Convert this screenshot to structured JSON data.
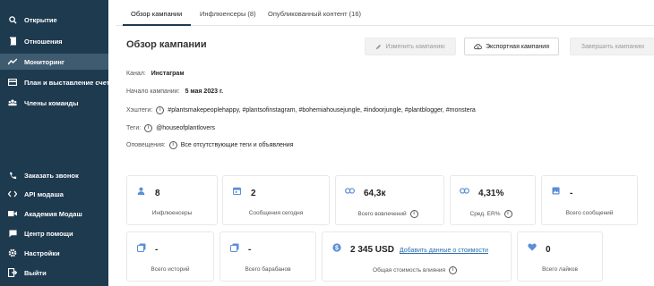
{
  "sidebar": {
    "top_items": [
      {
        "label": "Открытие",
        "icon": "search-icon"
      },
      {
        "label": "Отношения",
        "icon": "document-icon"
      },
      {
        "label": "Мониторинг",
        "icon": "trend-icon",
        "active": true
      },
      {
        "label": "План и выставление счето",
        "icon": "card-icon"
      },
      {
        "label": "Члены команды",
        "icon": "team-icon"
      }
    ],
    "bottom_items": [
      {
        "label": "Заказать звонок",
        "icon": "phone-icon"
      },
      {
        "label": "API модаша",
        "icon": "code-icon"
      },
      {
        "label": "Академия Модаш",
        "icon": "video-icon"
      },
      {
        "label": "Центр помощи",
        "icon": "chat-icon"
      },
      {
        "label": "Настройки",
        "icon": "gear-icon"
      },
      {
        "label": "Выйти",
        "icon": "logout-icon"
      }
    ]
  },
  "tabs": [
    {
      "label": "Обзор кампании",
      "active": true
    },
    {
      "label": "Инфлюенсеры (8)"
    },
    {
      "label": "Опубликованный контент (16)"
    }
  ],
  "header": {
    "title": "Обзор кампании",
    "edit_button": "Изменить кампанию",
    "export_button": "Экспортная кампания",
    "finish_button": "Завершить кампанию"
  },
  "details": {
    "channel_label": "Канал:",
    "channel_value": "Инстаграм",
    "start_label": "Начало кампании:",
    "start_value": "5 мая 2023 г.",
    "hashtags_label": "Хэштеги:",
    "hashtags_value": "#plantsmakepeoplehappy, #plantsofinstagram, #bohemiahousejungle, #indoorjungle, #plantblogger, #monstera",
    "tags_label": "Теги:",
    "tags_value": "@houseofplantlovers",
    "alerts_label": "Оповещения:",
    "alerts_value": "Все отсутствующие теги и объявления"
  },
  "stats_row1": [
    {
      "value": "8",
      "label": "Инфлюенсеры",
      "icon": "person-icon"
    },
    {
      "value": "2",
      "label": "Сообщения сегодня",
      "icon": "calendar-icon"
    },
    {
      "value": "64,3к",
      "label": "Всего вовлечений",
      "icon": "link-icon",
      "info": true
    },
    {
      "value": "4,31%",
      "label": "Сред. ER%",
      "icon": "link-icon",
      "info": true
    },
    {
      "value": "-",
      "label": "Всего сообщений",
      "icon": "image-icon"
    }
  ],
  "stats_row2": [
    {
      "value": "-",
      "label": "Всего историй",
      "icon": "stories-icon"
    },
    {
      "value": "-",
      "label": "Всего барабанов",
      "icon": "reels-icon"
    },
    {
      "value": "2 345 USD",
      "label": "Общая стоимость влияния",
      "icon": "dollar-icon",
      "info": true,
      "link": "Добавить данные о стоимости"
    },
    {
      "value": "0",
      "label": "Всего лайков",
      "icon": "heart-icon"
    }
  ],
  "colors": {
    "sidebar": "#1e3a4f",
    "sidebar_active": "#3f5b6f",
    "icon_blue": "#5b8fd6",
    "link": "#2a6db0"
  }
}
